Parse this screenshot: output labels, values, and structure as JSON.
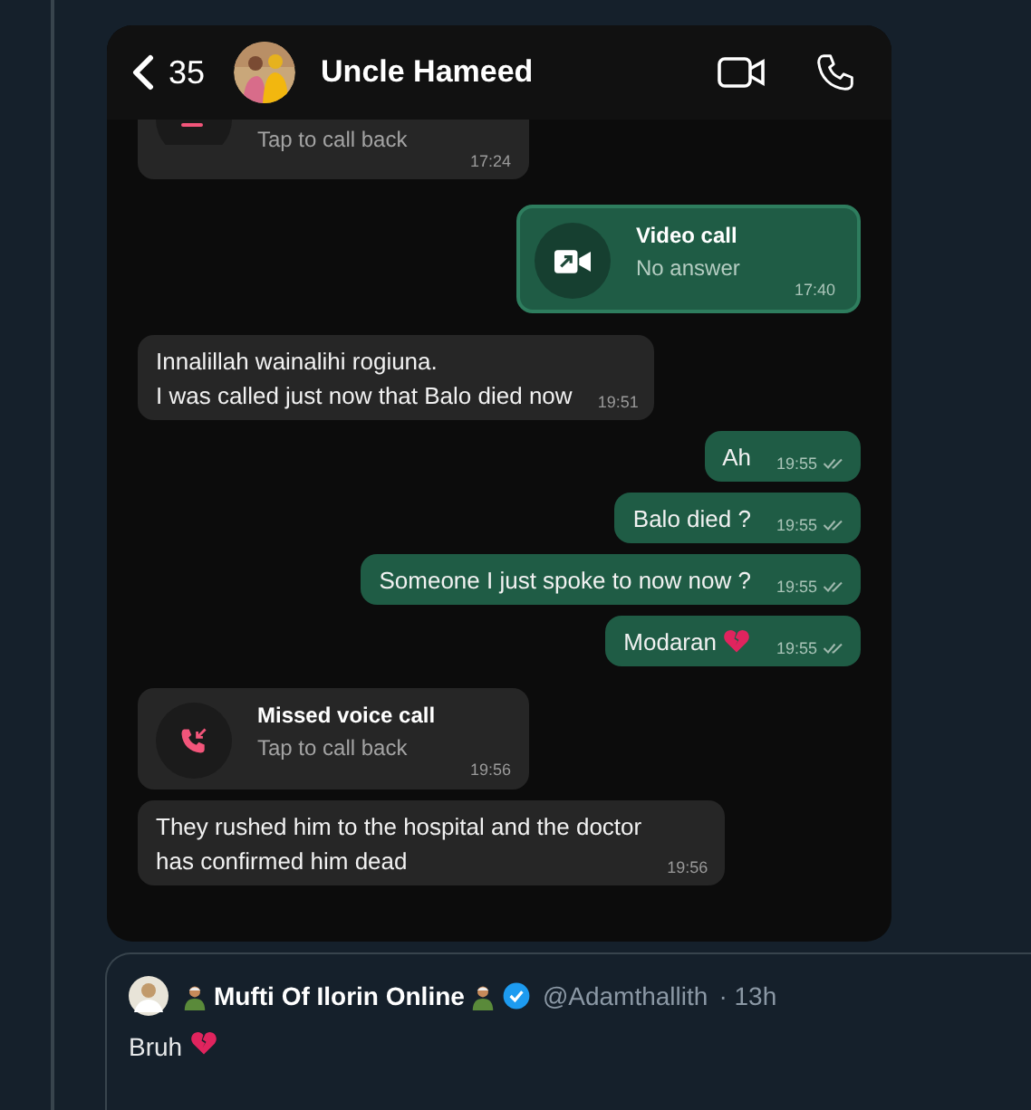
{
  "chat": {
    "back_count": "35",
    "contact_name": "Uncle Hameed",
    "messages": [
      {
        "kind": "call",
        "outgoing": false,
        "video": false,
        "subtitle": "Tap to call back",
        "time": "17:24",
        "clipped": true
      },
      {
        "kind": "call",
        "outgoing": true,
        "video": true,
        "title": "Video call",
        "subtitle": "No answer",
        "time": "17:40"
      },
      {
        "kind": "text",
        "outgoing": false,
        "text": "Innalillah wainalihi rogiuna.\nI was called just now that Balo died now",
        "time": "19:51"
      },
      {
        "kind": "text",
        "outgoing": true,
        "text": "Ah",
        "time": "19:55",
        "read": false
      },
      {
        "kind": "text",
        "outgoing": true,
        "text": "Balo died ?",
        "time": "19:55",
        "read": false
      },
      {
        "kind": "text",
        "outgoing": true,
        "text": "Someone I just spoke to now now ?",
        "time": "19:55",
        "read": false
      },
      {
        "kind": "text",
        "outgoing": true,
        "text": "Modaran",
        "broken_heart": true,
        "time": "19:55",
        "read": false
      },
      {
        "kind": "call",
        "outgoing": false,
        "video": false,
        "title": "Missed voice call",
        "subtitle": "Tap to call back",
        "time": "19:56"
      },
      {
        "kind": "text",
        "outgoing": false,
        "text": "They rushed him to the hospital and the doctor\nhas confirmed him dead",
        "time": "19:56"
      }
    ]
  },
  "quote": {
    "author": "Mufti Of Ilorin Online",
    "verified": true,
    "handle": "@Adamthallith",
    "age": "· 13h",
    "text": "Bruh",
    "broken_heart": true
  }
}
